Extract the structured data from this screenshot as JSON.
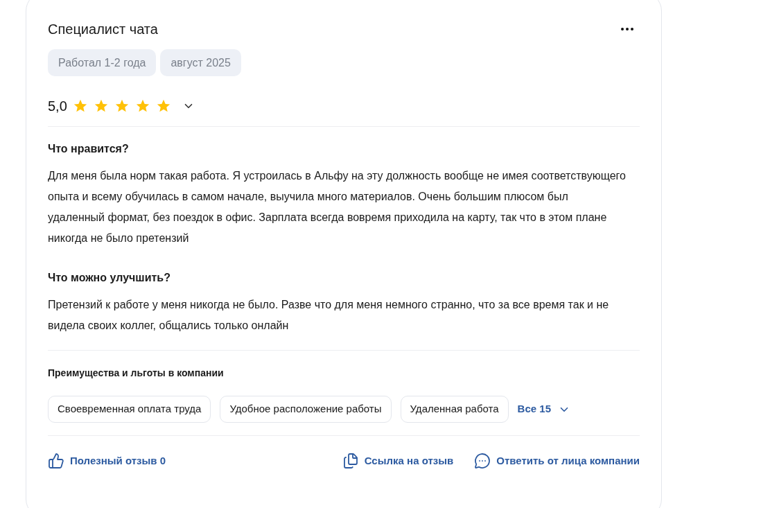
{
  "review": {
    "title": "Специалист чата",
    "tags": [
      "Работал 1-2 года",
      "август 2025"
    ],
    "rating": {
      "value": "5,0",
      "stars": 5
    },
    "sections": [
      {
        "heading": "Что нравится?",
        "text": "Для меня была норм такая работа. Я устроилась в Альфу на эту должность вообще не имея соответствующего опыта и всему обучилась в самом начале, выучила много материалов. Очень большим плюсом был удаленный формат, без поездок в офис. Зарплата всегда вовремя приходила на карту, так что в этом плане никогда не было претензий"
      },
      {
        "heading": "Что можно улучшить?",
        "text": "Претензий к работе у меня никогда не было. Разве что для меня немного странно, что за все время так и не видела своих коллег, общались только онлайн"
      }
    ],
    "benefits": {
      "heading": "Преимущества и льготы в компании",
      "items": [
        "Своевременная оплата труда",
        "Удобное расположение работы",
        "Удаленная работа"
      ],
      "more": "Все 15"
    },
    "actions": [
      {
        "kind": "like",
        "label": "Полезный отзыв 0"
      },
      {
        "kind": "link",
        "label": "Ссылка на отзыв"
      },
      {
        "kind": "reply",
        "label": "Ответить от лица компании"
      }
    ]
  }
}
